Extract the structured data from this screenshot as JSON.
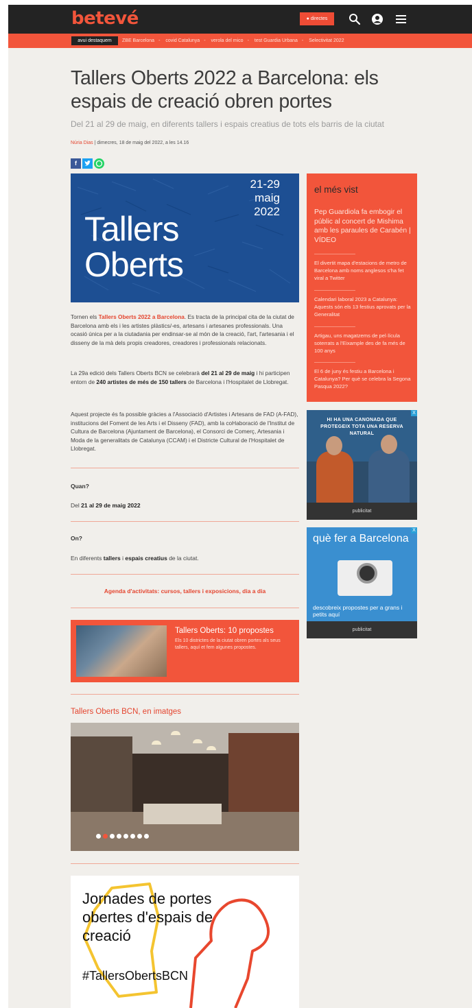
{
  "header": {
    "logo": "betevé",
    "live_label": "● directes",
    "icons": [
      "search-icon",
      "user-icon",
      "menu-icon"
    ]
  },
  "subnav": {
    "featured_label": "avui destaquem",
    "topics": [
      "ZBE Barcelona",
      "covid Catalunya",
      "verola del mico",
      "test Guardia Urbana",
      "Selectivitat 2022"
    ],
    "separator": "-"
  },
  "article": {
    "title": "Tallers Oberts 2022 a Barcelona: els espais de creació obren portes",
    "subtitle": "Del 21 al 29 de maig, en diferents tallers i espais creatius de tots els barris de la ciutat",
    "author": "Núria Dias",
    "date": "dimecres, 18 de maig del 2022, a les 14.16",
    "share": {
      "facebook": "f",
      "twitter": "t",
      "whatsapp": "w"
    },
    "hero": {
      "date_range": "21-29 maig 2022",
      "date_1": "21-29",
      "date_2": "maig",
      "date_3": "2022",
      "title_1": "Tallers",
      "title_2": "Oberts"
    },
    "p1": {
      "a": "Tornen els ",
      "b": "Tallers Oberts 2022 a Barcelona",
      "c": ". Es tracta de la principal cita de la ciutat de Barcelona amb els i les artistes plàstics/-es, artesans i artesanes professionals. Una ocasió única per a la ciutadania per endinsar-se al món de la creació, l'art, l'artesania i el disseny de la mà dels propis creadores, creadores i professionals relacionats."
    },
    "p2": {
      "a": "La 29a edició dels Tallers Oberts BCN se celebrarà ",
      "b": "del 21 al 29 de maig",
      "c": " i hi participen entorn de ",
      "d": "240 artistes de més de 150 tallers",
      "e": " de Barcelona i l'Hospitalet de Llobregat."
    },
    "p3": "Aquest projecte és fa possible gràcies a l'Associació d'Artistes i Artesans de FAD (A-FAD), institucions del Foment de les Arts i el Disseny (FAD), amb la coHaboració de l'Institut de Cultura de Barcelona (Ajuntament de Barcelona), el Consorci de Comerç, Artesania i Moda de la generalitats de Catalunya (CCAM) i el Districte Cultural de l'Hospitalet de Llobregat.",
    "when": {
      "label": "Quan?",
      "a": "Del ",
      "b": "21 al 29 de maig 2022"
    },
    "where": {
      "label": "On?",
      "a": "En diferents ",
      "b": "tallers",
      "c": " i ",
      "d": "espais creatius",
      "e": " de la ciutat."
    },
    "agenda_link": "Agenda d'activitats: cursos, tallers i exposicions, dia a dia",
    "promo": {
      "title": "Tallers Oberts: 10 propostes",
      "description": "Els 10 districtes de la ciutat obren portes als seus tallers, aquí et fem algunes propostes."
    },
    "gallery": {
      "title": "Tallers Oberts BCN, en imatges",
      "slide_count": 8,
      "active_slide": 2
    },
    "poster": {
      "line_1": "Jornades de portes",
      "line_2": "obertes d'espais de",
      "line_3": "creació",
      "hashtag": "#TallersObertsBCN"
    }
  },
  "sidebar": {
    "most_viewed_title": "el més vist",
    "items": [
      "Pep Guardiola fa embogir el públic al concert de Mishima amb les paraules de Carabén | VÍDEO",
      "El divertit mapa d'estacions de metro de Barcelona amb noms anglesos s'ha fet viral a Twitter",
      "Calendari laboral 2023 a Catalunya: Aquests són els 13 festius aprovats per la Generalitat",
      "Artigau, uns magatzems de pel·lícula soterrats a l'Eixample des de fa més de 100 anys",
      "El 6 de juny és festiu a Barcelona i Catalunya? Per què se celebra la Segona Pasqua 2022?"
    ],
    "ad1": {
      "headline": "HI HA UNA CANONADA QUE PROTEGEIX TOTA UNA RESERVA NATURAL",
      "label": "publicitat",
      "close": "X"
    },
    "ad2": {
      "title": "què fer a Barcelona",
      "subtitle": "descobreix propostes per a grans i petits aquí",
      "label": "publicitat",
      "close": "X"
    }
  },
  "colors": {
    "brand": "#f2553b",
    "dark": "#232323",
    "background": "#f1efeb",
    "hero_blue": "#1c4f92"
  }
}
